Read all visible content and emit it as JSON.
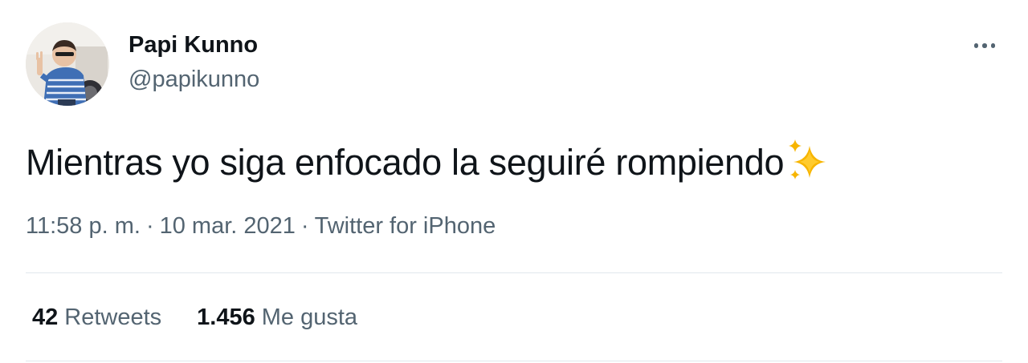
{
  "author": {
    "display_name": "Papi Kunno",
    "handle": "@papikunno"
  },
  "tweet": {
    "text": "Mientras yo siga enfocado la seguiré rompiendo",
    "emoji": "sparkles-icon"
  },
  "meta": {
    "time": "11:58 p. m.",
    "separator": "·",
    "date": "10 mar. 2021",
    "source": "Twitter for iPhone"
  },
  "stats": {
    "retweets_count": "42",
    "retweets_label": "Retweets",
    "likes_count": "1.456",
    "likes_label": "Me gusta"
  },
  "colors": {
    "text_primary": "#0f1419",
    "text_secondary": "#536471",
    "divider": "#e1e8ed",
    "sparkle": "#f4b400"
  }
}
